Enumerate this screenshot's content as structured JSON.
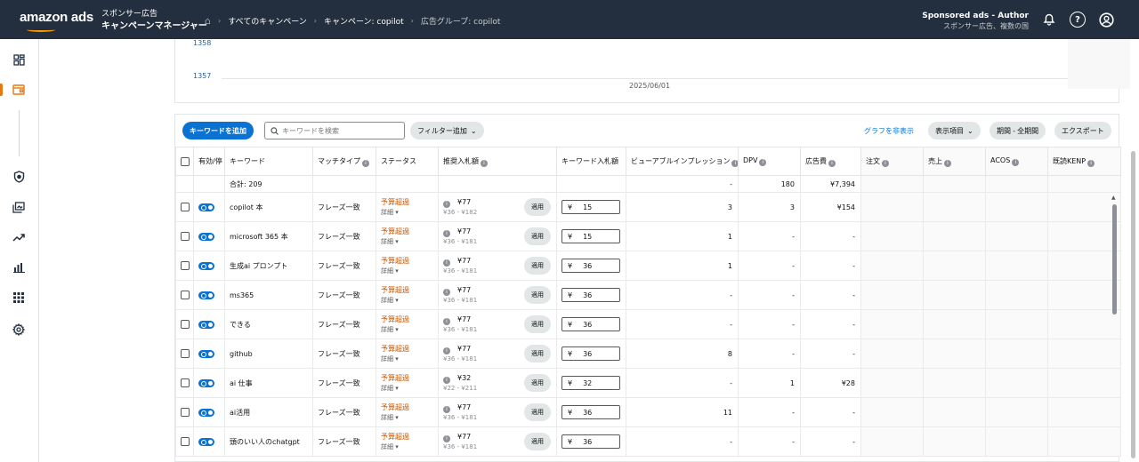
{
  "header": {
    "logo": "amazon ads",
    "product_line1": "スポンサー広告",
    "product_line2": "キャンペーンマネージャー",
    "breadcrumbs": [
      "すべてのキャンペーン",
      "キャンペーン: copilot",
      "広告グループ: copilot"
    ],
    "account_line1": "Sponsored ads - Author",
    "account_line2": "スポンサー広告、複数の国"
  },
  "chart": {
    "y_ticks": [
      "1358",
      "1357"
    ],
    "x_tick": "2025/06/01"
  },
  "toolbar": {
    "add_keyword": "キーワードを追加",
    "search_placeholder": "キーワードを検索",
    "filter": "フィルター追加",
    "hide_graph": "グラフを非表示",
    "columns": "表示項目",
    "period": "期間 - 全期間",
    "export": "エクスポート"
  },
  "table": {
    "headers": {
      "enabled": "有効/停",
      "keyword": "キーワード",
      "match": "マッチタイプ",
      "status": "ステータス",
      "suggested": "推奨入札額",
      "bid": "キーワード入札額",
      "viewable": "ビューアブルインプレッション",
      "dpv": "DPV",
      "spend": "広告費",
      "orders": "注文",
      "sales": "売上",
      "acos": "ACOS",
      "kenp": "既読KENP"
    },
    "total": {
      "label": "合計: 209",
      "viewable": "-",
      "dpv": "180",
      "spend": "¥7,394"
    },
    "detail_label": "詳細",
    "apply_label": "適用",
    "currency": "¥",
    "rows": [
      {
        "keyword": "copilot 本",
        "match": "フレーズ一致",
        "status": "予算超過",
        "suggested": "¥77",
        "range": "¥36 - ¥182",
        "bid": "15",
        "viewable": "3",
        "dpv": "3",
        "spend": "¥154"
      },
      {
        "keyword": "microsoft 365 本",
        "match": "フレーズ一致",
        "status": "予算超過",
        "suggested": "¥77",
        "range": "¥36 - ¥181",
        "bid": "15",
        "viewable": "1",
        "dpv": "-",
        "spend": "-"
      },
      {
        "keyword": "生成ai プロンプト",
        "match": "フレーズ一致",
        "status": "予算超過",
        "suggested": "¥77",
        "range": "¥36 - ¥181",
        "bid": "36",
        "viewable": "1",
        "dpv": "-",
        "spend": "-"
      },
      {
        "keyword": "ms365",
        "match": "フレーズ一致",
        "status": "予算超過",
        "suggested": "¥77",
        "range": "¥36 - ¥181",
        "bid": "36",
        "viewable": "-",
        "dpv": "-",
        "spend": "-"
      },
      {
        "keyword": "できる",
        "match": "フレーズ一致",
        "status": "予算超過",
        "suggested": "¥77",
        "range": "¥36 - ¥181",
        "bid": "36",
        "viewable": "-",
        "dpv": "-",
        "spend": "-"
      },
      {
        "keyword": "github",
        "match": "フレーズ一致",
        "status": "予算超過",
        "suggested": "¥77",
        "range": "¥36 - ¥181",
        "bid": "36",
        "viewable": "8",
        "dpv": "-",
        "spend": "-"
      },
      {
        "keyword": "ai 仕事",
        "match": "フレーズ一致",
        "status": "予算超過",
        "suggested": "¥32",
        "range": "¥22 - ¥211",
        "bid": "32",
        "viewable": "-",
        "dpv": "1",
        "spend": "¥28"
      },
      {
        "keyword": "ai活用",
        "match": "フレーズ一致",
        "status": "予算超過",
        "suggested": "¥77",
        "range": "¥36 - ¥181",
        "bid": "36",
        "viewable": "11",
        "dpv": "-",
        "spend": "-"
      },
      {
        "keyword": "頭のいい人のchatgpt",
        "match": "フレーズ一致",
        "status": "予算超過",
        "suggested": "¥77",
        "range": "¥36 - ¥181",
        "bid": "36",
        "viewable": "-",
        "dpv": "-",
        "spend": "-"
      }
    ]
  }
}
